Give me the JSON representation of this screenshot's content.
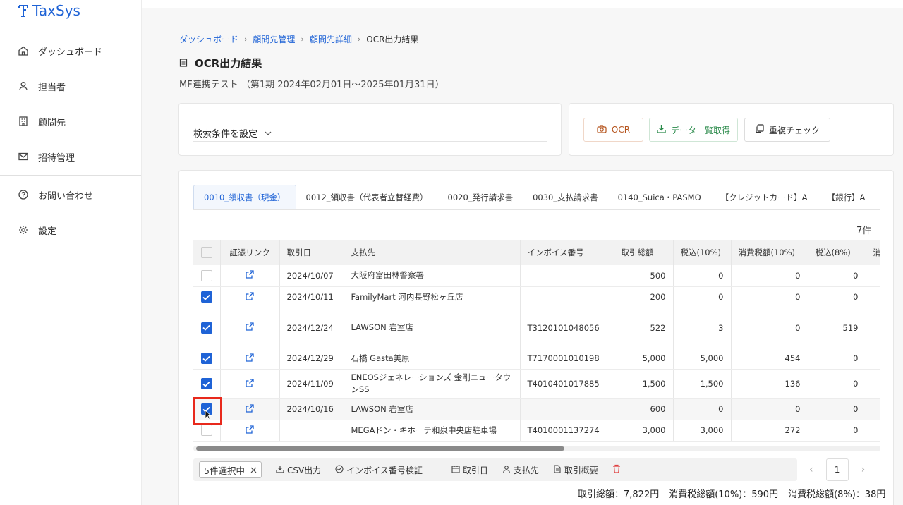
{
  "app": {
    "name": "TaxSys"
  },
  "sidebar": {
    "items": [
      {
        "label": "ダッシュボード",
        "icon": "home-icon"
      },
      {
        "label": "担当者",
        "icon": "user-icon"
      },
      {
        "label": "顧問先",
        "icon": "building-icon"
      },
      {
        "label": "招待管理",
        "icon": "mail-icon"
      },
      {
        "label": "お問い合わせ",
        "icon": "help-icon"
      },
      {
        "label": "設定",
        "icon": "gear-icon"
      }
    ]
  },
  "breadcrumb": [
    "ダッシュボード",
    "顧問先管理",
    "顧問先詳細",
    "OCR出力結果"
  ],
  "page": {
    "title": "OCR出力結果",
    "subtitle": "MF連携テスト （第1期 2024年02月01日〜2025年01月31日）"
  },
  "search": {
    "label": "検索条件を設定"
  },
  "actions": {
    "ocr": "OCR",
    "download": "データ一覧取得",
    "duplicate": "重複チェック"
  },
  "tabs": [
    "0010_領収書（現金）",
    "0012_領収書（代表者立替経費）",
    "0020_発行請求書",
    "0030_支払請求書",
    "0140_Suica・PASMO",
    "【クレジットカード】A",
    "【銀行】A"
  ],
  "count_label": "7件",
  "table": {
    "headers": [
      "証憑リンク",
      "取引日",
      "支払先",
      "インボイス番号",
      "取引総額",
      "税込(10%)",
      "消費税額(10%)",
      "税込(8%)",
      "消"
    ],
    "rows": [
      {
        "checked": false,
        "date": "2024/10/07",
        "payee": "大阪府富田林警察署",
        "invoice": "",
        "total": "500",
        "tax10_incl": "0",
        "tax10": "0",
        "tax8_incl": "0"
      },
      {
        "checked": true,
        "date": "2024/10/11",
        "payee": "FamilyMart 河内長野松ヶ丘店",
        "invoice": "",
        "total": "200",
        "tax10_incl": "0",
        "tax10": "0",
        "tax8_incl": "0"
      },
      {
        "checked": true,
        "date": "2024/12/24",
        "payee": "LAWSON 岩室店",
        "invoice": "T3120101048056",
        "total": "522",
        "tax10_incl": "3",
        "tax10": "0",
        "tax8_incl": "519"
      },
      {
        "checked": true,
        "date": "2024/12/29",
        "payee": "石橋 Gasta美原",
        "invoice": "T7170001010198",
        "total": "5,000",
        "tax10_incl": "5,000",
        "tax10": "454",
        "tax8_incl": "0"
      },
      {
        "checked": true,
        "date": "2024/11/09",
        "payee": "ENEOSジェネレーションズ 金剛ニュータウンSS",
        "invoice": "T4010401017885",
        "total": "1,500",
        "tax10_incl": "1,500",
        "tax10": "136",
        "tax8_incl": "0"
      },
      {
        "checked": true,
        "date": "2024/10/16",
        "payee": "LAWSON 岩室店",
        "invoice": "",
        "total": "600",
        "tax10_incl": "0",
        "tax10": "0",
        "tax8_incl": "0"
      },
      {
        "checked": false,
        "date": "",
        "payee": "MEGAドン・キホーテ和泉中央店駐車場",
        "invoice": "T4010001137274",
        "total": "3,000",
        "tax10_incl": "3,000",
        "tax10": "272",
        "tax8_incl": "0"
      }
    ]
  },
  "bulk": {
    "selected": "5件選択中",
    "csv": "CSV出力",
    "invoice_check": "インボイス番号検証",
    "date": "取引日",
    "payee": "支払先",
    "summary": "取引概要"
  },
  "pager": {
    "page": "1"
  },
  "totals": [
    "取引総額：7,822円",
    "消費税総額(10%)：590円",
    "消費税総額(8%)：38円"
  ],
  "colors": {
    "accent": "#1f63d6",
    "highlight": "#e8291c"
  }
}
